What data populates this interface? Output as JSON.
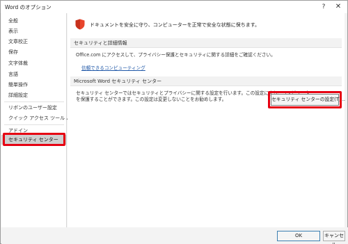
{
  "window": {
    "title": "Word のオプション",
    "help_label": "?",
    "close_label": "✕"
  },
  "sidebar": {
    "items": [
      {
        "label": "全般"
      },
      {
        "label": "表示"
      },
      {
        "label": "文章校正"
      },
      {
        "label": "保存"
      },
      {
        "label": "文字体裁"
      },
      {
        "label": "言語"
      },
      {
        "label": "簡単操作"
      },
      {
        "label": "詳細設定"
      },
      {
        "label": "リボンのユーザー設定"
      },
      {
        "label": "クイック アクセス ツール バー"
      },
      {
        "label": "アドイン"
      },
      {
        "label": "セキュリティ センター",
        "selected": true
      }
    ]
  },
  "main": {
    "banner": "ドキュメントを安全に守り、コンピューターを正常で安全な状態に保ちます。",
    "security_section": {
      "heading": "セキュリティと詳細情報",
      "text": "Office.com にアクセスして、プライバシー保護とセキュリティに関する詳細をご確認ください。",
      "link": "信頼できるコンピューティング"
    },
    "trust_center_section": {
      "heading": "Microsoft Word セキュリティ センター",
      "text_line1": "セキュリティ センターではセキュリティとプライバシーに関する設定を行います。この設定により、コンピューター",
      "text_line2": "を保護することができます。この設定は変更しないことをお勧めします。",
      "button_label": "セキュリティ センターの設定(T)..."
    }
  },
  "footer": {
    "ok_label": "OK",
    "cancel_label": "キャンセル"
  },
  "colors": {
    "highlight": "#e60012",
    "link": "#1f57a7",
    "shield": "#e8452c"
  },
  "icons": {
    "banner": "shield-icon"
  }
}
